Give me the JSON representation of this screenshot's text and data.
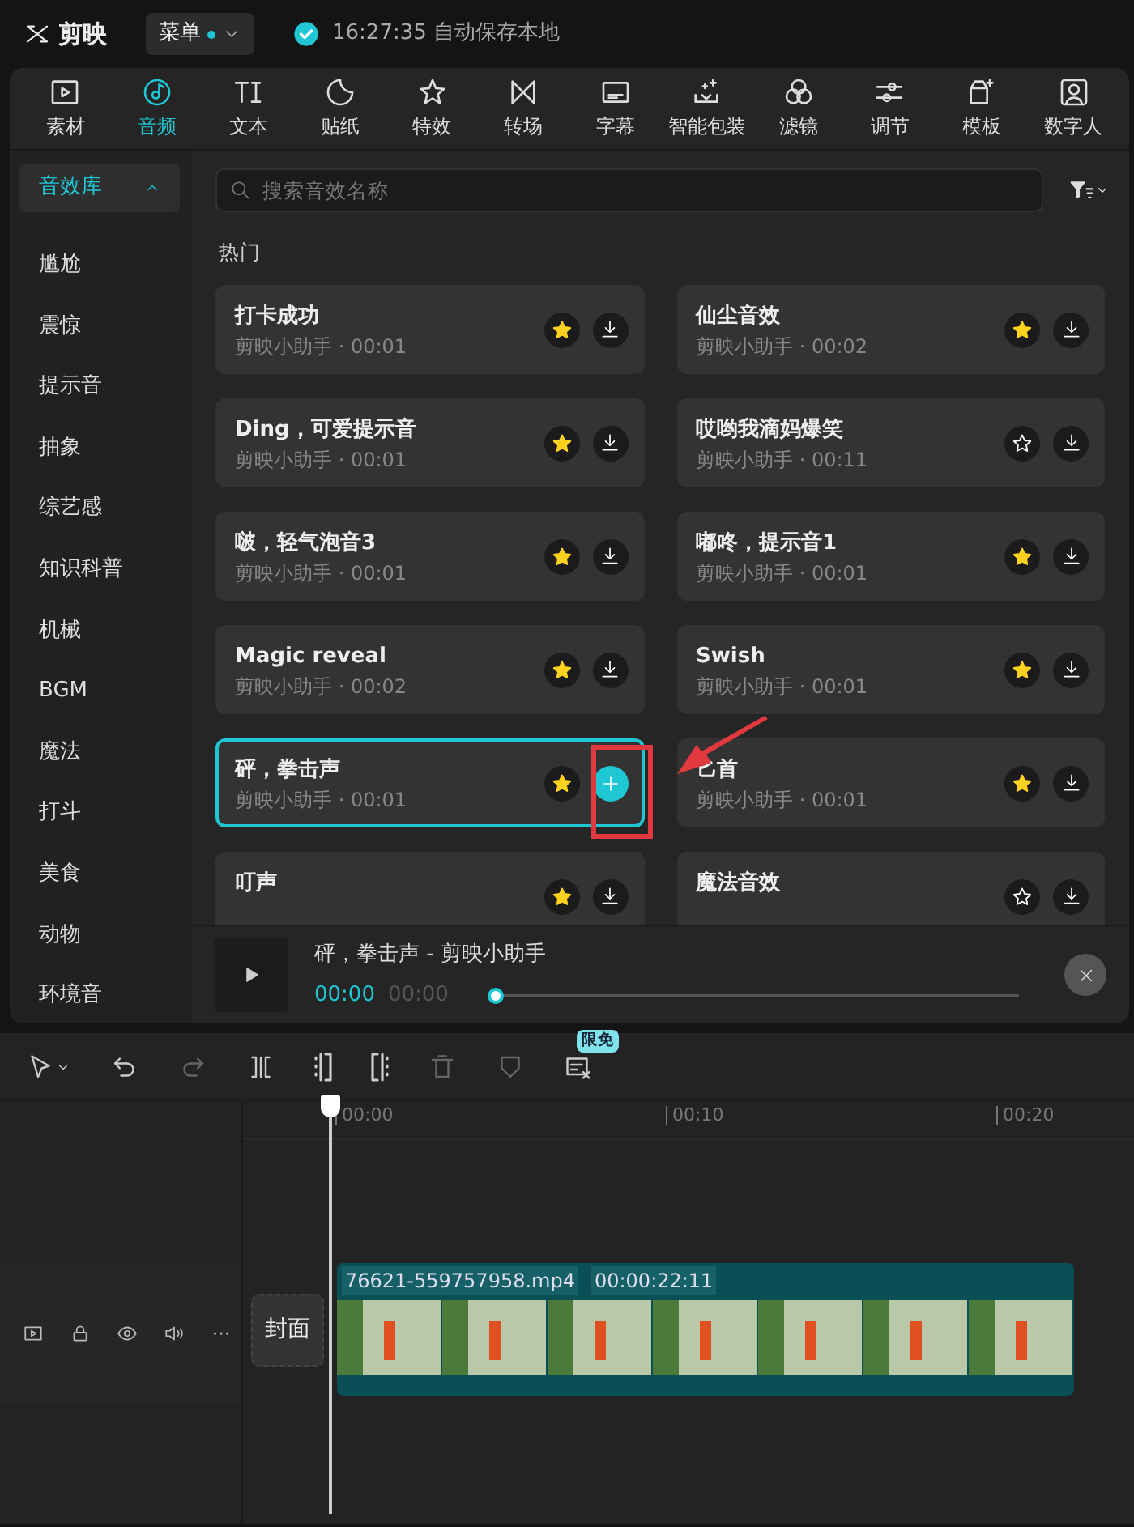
{
  "app": {
    "logo": "剪映",
    "menu_button": "菜单",
    "menu_badge": true,
    "save_status": "16:27:35 自动保存本地"
  },
  "tool_tabs": [
    {
      "label": "素材",
      "selected": false
    },
    {
      "label": "音频",
      "selected": true
    },
    {
      "label": "文本",
      "selected": false
    },
    {
      "label": "贴纸",
      "selected": false
    },
    {
      "label": "特效",
      "selected": false
    },
    {
      "label": "转场",
      "selected": false
    },
    {
      "label": "字幕",
      "selected": false
    },
    {
      "label": "智能包装",
      "selected": false
    },
    {
      "label": "滤镜",
      "selected": false
    },
    {
      "label": "调节",
      "selected": false
    },
    {
      "label": "模板",
      "selected": false
    },
    {
      "label": "数字人",
      "selected": false
    }
  ],
  "sidebar": {
    "items": [
      {
        "label": "音效库",
        "selected": true,
        "expanded": true
      },
      {
        "label": "尴尬",
        "selected": false
      },
      {
        "label": "震惊",
        "selected": false
      },
      {
        "label": "提示音",
        "selected": false
      },
      {
        "label": "抽象",
        "selected": false
      },
      {
        "label": "综艺感",
        "selected": false
      },
      {
        "label": "知识科普",
        "selected": false
      },
      {
        "label": "机械",
        "selected": false
      },
      {
        "label": "BGM",
        "selected": false
      },
      {
        "label": "魔法",
        "selected": false
      },
      {
        "label": "打斗",
        "selected": false
      },
      {
        "label": "美食",
        "selected": false
      },
      {
        "label": "动物",
        "selected": false
      },
      {
        "label": "环境音",
        "selected": false
      }
    ]
  },
  "search": {
    "placeholder": "搜索音效名称"
  },
  "section_title": "热门",
  "sounds": [
    {
      "title": "打卡成功",
      "subtitle": "剪映小助手 · 00:01",
      "favorited": true,
      "selected": false,
      "annotated": false
    },
    {
      "title": "仙尘音效",
      "subtitle": "剪映小助手 · 00:02",
      "favorited": true,
      "selected": false,
      "annotated": false
    },
    {
      "title": "Ding，可爱提示音",
      "subtitle": "剪映小助手 · 00:01",
      "favorited": true,
      "selected": false,
      "annotated": false
    },
    {
      "title": "哎哟我滴妈爆笑",
      "subtitle": "剪映小助手 · 00:11",
      "favorited": false,
      "selected": false,
      "annotated": false
    },
    {
      "title": "啵，轻气泡音3",
      "subtitle": "剪映小助手 · 00:01",
      "favorited": true,
      "selected": false,
      "annotated": false
    },
    {
      "title": "嘟咚，提示音1",
      "subtitle": "剪映小助手 · 00:01",
      "favorited": true,
      "selected": false,
      "annotated": false
    },
    {
      "title": "Magic reveal",
      "subtitle": "剪映小助手 · 00:02",
      "favorited": true,
      "selected": false,
      "annotated": false
    },
    {
      "title": "Swish",
      "subtitle": "剪映小助手 · 00:01",
      "favorited": true,
      "selected": false,
      "annotated": false
    },
    {
      "title": "砰，拳击声",
      "subtitle": "剪映小助手 · 00:01",
      "favorited": true,
      "selected": true,
      "annotated": true
    },
    {
      "title": "匕首",
      "subtitle": "剪映小助手 · 00:01",
      "favorited": true,
      "selected": false,
      "annotated": false
    },
    {
      "title": "叮声",
      "favorited": true,
      "selected": false,
      "annotated": false
    },
    {
      "title": "魔法音效",
      "favorited": false,
      "selected": false,
      "annotated": false
    }
  ],
  "player": {
    "title": "砰，拳击声 - 剪映小助手",
    "current_time": "00:00",
    "total_time": "00:00",
    "level": 0
  },
  "timeline": {
    "toolbar_badge": "限免",
    "ruler": [
      "00:00",
      "00:10",
      "00:20"
    ],
    "cover_button": "封面",
    "clip": {
      "filename": "76621-559757958.mp4",
      "duration": "00:00:22:11"
    }
  }
}
